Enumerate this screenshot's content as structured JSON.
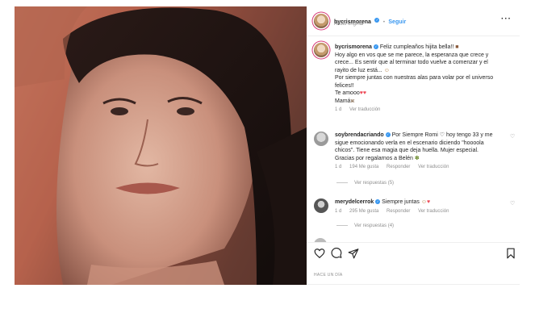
{
  "header": {
    "username": "bycrismorena",
    "dot": "•",
    "follow_label": "Seguir",
    "audio": "Audio original",
    "more_icon": "more-horizontal-icon"
  },
  "caption": {
    "username": "bycrismorena",
    "first_line": "Feliz cumpleaños hijita bella!!",
    "line2": "Hoy algo en vos que se me parece, la esperanza que crece y",
    "line3": "crece... Es sentir que al terminar todo vuelve a comenzar y el",
    "line4": "rayito de luz está...",
    "line5": "Por siempre juntas con nuestras alas para volar por el universo",
    "line6": "felices!!",
    "line7": "Te amooo",
    "line8": "Mamá",
    "time": "1 d",
    "translate": "Ver traducción"
  },
  "comments": [
    {
      "username": "soybrendacriando",
      "line1": "Por Siempre Romi ♡ hoy tengo 33 y me",
      "line2": "sigue emocionando verla en el escenario diciendo \"hoooola",
      "line3": "chicos\". Tiene esa magia que deja huella. Mujer especial.",
      "line4": "Gracias por regalarnos a Belén",
      "time": "1 d",
      "likes": "194 Me gusta",
      "reply": "Responder",
      "translate": "Ver traducción",
      "view_replies": "Ver respuestas (5)"
    },
    {
      "username": "merydelcerrok",
      "line1": "Siempre juntas",
      "time": "1 d",
      "likes": "295 Me gusta",
      "reply": "Responder",
      "translate": "Ver traducción",
      "view_replies": "Ver respuestas (4)"
    }
  ],
  "footer": {
    "date": "HACE UN DÍA"
  },
  "colors": {
    "link": "#3897f0",
    "muted": "#8e8e8e",
    "heart": "#ed4956"
  }
}
